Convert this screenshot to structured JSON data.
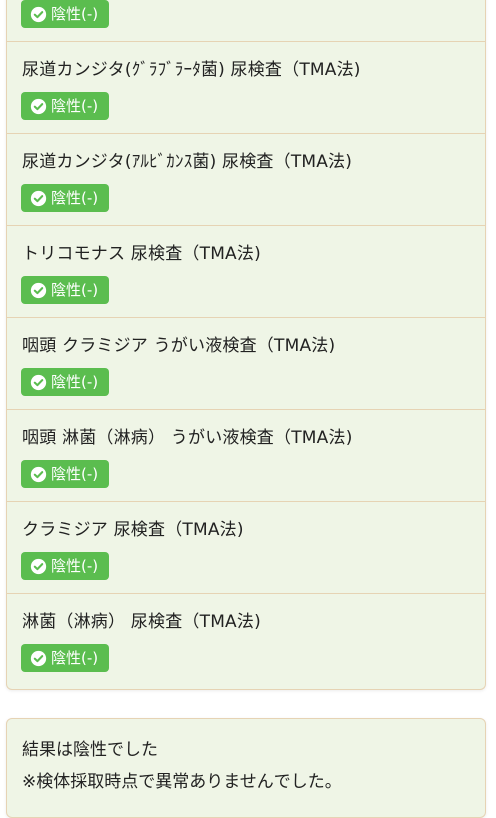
{
  "results": {
    "top_partial": {
      "result": "陰性(-)"
    },
    "tests": [
      {
        "name": "尿道カンジタ(ｸﾞﾗﾌﾞﾗｰﾀ菌) 尿検査（TMA法)",
        "result": "陰性(-)"
      },
      {
        "name": "尿道カンジタ(ｱﾙﾋﾞｶﾝｽ菌) 尿検査（TMA法)",
        "result": "陰性(-)"
      },
      {
        "name": "トリコモナス 尿検査（TMA法)",
        "result": "陰性(-)"
      },
      {
        "name": "咽頭 クラミジア うがい液検査（TMA法)",
        "result": "陰性(-)"
      },
      {
        "name": "咽頭 淋菌（淋病） うがい液検査（TMA法)",
        "result": "陰性(-)"
      },
      {
        "name": "クラミジア 尿検査（TMA法)",
        "result": "陰性(-)"
      },
      {
        "name": "淋菌（淋病） 尿検査（TMA法)",
        "result": "陰性(-)"
      }
    ]
  },
  "summary": {
    "line1": "結果は陰性でした",
    "line2": "※検体採取時点で異常ありませんでした。"
  },
  "colors": {
    "card_bg": "#eff5e6",
    "divider": "#e6d3b4",
    "badge_bg": "#5bbd4f",
    "badge_text": "#ffffff"
  },
  "icons": {
    "badge": "check-circle-icon"
  }
}
